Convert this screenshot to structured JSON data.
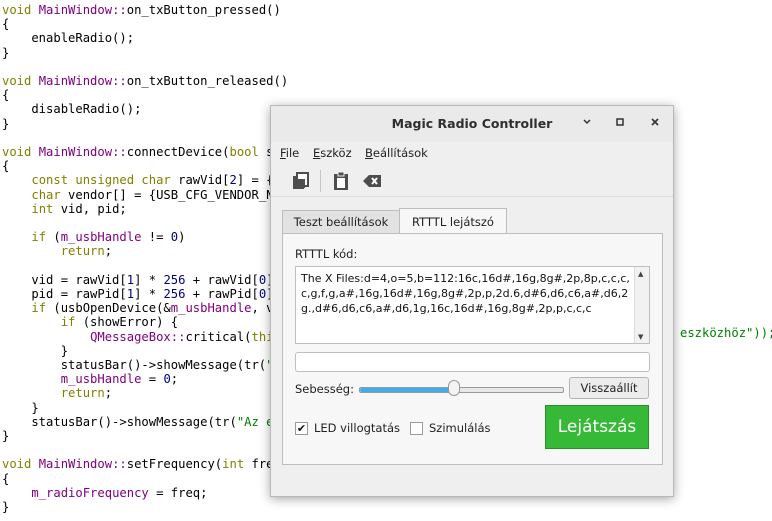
{
  "code_lines": [
    {
      "parts": [
        {
          "t": "void ",
          "c": "kw"
        },
        {
          "t": "MainWindow",
          "c": "cls"
        },
        {
          "t": "::",
          "c": "sym"
        },
        {
          "t": "on_txButton_pressed()",
          "c": ""
        }
      ]
    },
    {
      "parts": [
        {
          "t": "{",
          "c": ""
        }
      ]
    },
    {
      "parts": [
        {
          "t": "    enableRadio();",
          "c": ""
        }
      ]
    },
    {
      "parts": [
        {
          "t": "}",
          "c": ""
        }
      ]
    },
    {
      "parts": [
        {
          "t": "",
          "c": ""
        }
      ]
    },
    {
      "parts": [
        {
          "t": "void ",
          "c": "kw"
        },
        {
          "t": "MainWindow",
          "c": "cls"
        },
        {
          "t": "::",
          "c": "sym"
        },
        {
          "t": "on_txButton_released()",
          "c": ""
        }
      ]
    },
    {
      "parts": [
        {
          "t": "{",
          "c": ""
        }
      ]
    },
    {
      "parts": [
        {
          "t": "    disableRadio();",
          "c": ""
        }
      ]
    },
    {
      "parts": [
        {
          "t": "}",
          "c": ""
        }
      ]
    },
    {
      "parts": [
        {
          "t": "",
          "c": ""
        }
      ]
    },
    {
      "parts": [
        {
          "t": "void ",
          "c": "kw"
        },
        {
          "t": "MainWindow",
          "c": "cls"
        },
        {
          "t": "::",
          "c": "sym"
        },
        {
          "t": "connectDevice(",
          "c": ""
        },
        {
          "t": "bool ",
          "c": "kw"
        },
        {
          "t": "sh",
          "c": ""
        }
      ]
    },
    {
      "parts": [
        {
          "t": "{",
          "c": ""
        }
      ]
    },
    {
      "parts": [
        {
          "t": "    ",
          "c": ""
        },
        {
          "t": "const unsigned char ",
          "c": "kw"
        },
        {
          "t": "rawVid[",
          "c": ""
        },
        {
          "t": "2",
          "c": "num"
        },
        {
          "t": "] = {U",
          "c": ""
        }
      ]
    },
    {
      "parts": [
        {
          "t": "    ",
          "c": ""
        },
        {
          "t": "char ",
          "c": "kw"
        },
        {
          "t": "vendor[] = {USB_CFG_VENDOR_NAM",
          "c": ""
        }
      ]
    },
    {
      "parts": [
        {
          "t": "    ",
          "c": ""
        },
        {
          "t": "int ",
          "c": "kw"
        },
        {
          "t": "vid, pid;",
          "c": ""
        }
      ]
    },
    {
      "parts": [
        {
          "t": "",
          "c": ""
        }
      ]
    },
    {
      "parts": [
        {
          "t": "    ",
          "c": ""
        },
        {
          "t": "if ",
          "c": "kw"
        },
        {
          "t": "(",
          "c": ""
        },
        {
          "t": "m_usbHandle",
          "c": "cls"
        },
        {
          "t": " != ",
          "c": ""
        },
        {
          "t": "0",
          "c": "num"
        },
        {
          "t": ")",
          "c": ""
        }
      ]
    },
    {
      "parts": [
        {
          "t": "        ",
          "c": ""
        },
        {
          "t": "return",
          "c": "kw"
        },
        {
          "t": ";",
          "c": ""
        }
      ]
    },
    {
      "parts": [
        {
          "t": "",
          "c": ""
        }
      ]
    },
    {
      "parts": [
        {
          "t": "    vid = rawVid[",
          "c": ""
        },
        {
          "t": "1",
          "c": "num"
        },
        {
          "t": "] * ",
          "c": ""
        },
        {
          "t": "256",
          "c": "num"
        },
        {
          "t": " + rawVid[",
          "c": ""
        },
        {
          "t": "0",
          "c": "num"
        },
        {
          "t": "];",
          "c": ""
        }
      ]
    },
    {
      "parts": [
        {
          "t": "    pid = rawPid[",
          "c": ""
        },
        {
          "t": "1",
          "c": "num"
        },
        {
          "t": "] * ",
          "c": ""
        },
        {
          "t": "256",
          "c": "num"
        },
        {
          "t": " + rawPid[",
          "c": ""
        },
        {
          "t": "0",
          "c": "num"
        },
        {
          "t": "];",
          "c": ""
        }
      ]
    },
    {
      "parts": [
        {
          "t": "    ",
          "c": ""
        },
        {
          "t": "if ",
          "c": "kw"
        },
        {
          "t": "(usbOpenDevice(&",
          "c": ""
        },
        {
          "t": "m_usbHandle",
          "c": "cls"
        },
        {
          "t": ", vi",
          "c": ""
        }
      ]
    },
    {
      "parts": [
        {
          "t": "        ",
          "c": ""
        },
        {
          "t": "if ",
          "c": "kw"
        },
        {
          "t": "(showError) {",
          "c": ""
        }
      ]
    },
    {
      "parts": [
        {
          "t": "            ",
          "c": ""
        },
        {
          "t": "QMessageBox",
          "c": "cls"
        },
        {
          "t": "::",
          "c": "sym"
        },
        {
          "t": "critical(",
          "c": ""
        },
        {
          "t": "this",
          "c": "kw"
        }
      ]
    },
    {
      "parts": [
        {
          "t": "        }",
          "c": ""
        }
      ]
    },
    {
      "parts": [
        {
          "t": "        statusBar()->showMessage(tr(",
          "c": ""
        },
        {
          "t": "\"N",
          "c": "str"
        }
      ]
    },
    {
      "parts": [
        {
          "t": "        ",
          "c": ""
        },
        {
          "t": "m_usbHandle",
          "c": "cls"
        },
        {
          "t": " = ",
          "c": ""
        },
        {
          "t": "0",
          "c": "num"
        },
        {
          "t": ";",
          "c": ""
        }
      ]
    },
    {
      "parts": [
        {
          "t": "        ",
          "c": ""
        },
        {
          "t": "return",
          "c": "kw"
        },
        {
          "t": ";",
          "c": ""
        }
      ]
    },
    {
      "parts": [
        {
          "t": "    }",
          "c": ""
        }
      ]
    },
    {
      "parts": [
        {
          "t": "    statusBar()->showMessage(tr(",
          "c": ""
        },
        {
          "t": "\"Az es",
          "c": "str"
        }
      ]
    },
    {
      "parts": [
        {
          "t": "}",
          "c": ""
        }
      ]
    },
    {
      "parts": [
        {
          "t": "",
          "c": ""
        }
      ]
    },
    {
      "parts": [
        {
          "t": "void ",
          "c": "kw"
        },
        {
          "t": "MainWindow",
          "c": "cls"
        },
        {
          "t": "::",
          "c": "sym"
        },
        {
          "t": "setFrequency(",
          "c": ""
        },
        {
          "t": "int ",
          "c": "kw"
        },
        {
          "t": "freq",
          "c": ""
        }
      ]
    },
    {
      "parts": [
        {
          "t": "{",
          "c": ""
        }
      ]
    },
    {
      "parts": [
        {
          "t": "    ",
          "c": ""
        },
        {
          "t": "m_radioFrequency",
          "c": "cls"
        },
        {
          "t": " = freq;",
          "c": ""
        }
      ]
    },
    {
      "parts": [
        {
          "t": "}",
          "c": ""
        }
      ]
    }
  ],
  "code_overflow_text": "eszközhöz\"));",
  "window": {
    "title": "Magic Radio Controller",
    "menu": {
      "file": "File",
      "device": "Eszköz",
      "settings": "Beállítások"
    },
    "tabs": [
      "Teszt beállítások",
      "RTTTL lejátszó"
    ],
    "rtttl_label": "RTTTL kód:",
    "rtttl_code": "The X Files:d=4,o=5,b=112:16c,16d#,16g,8g#,2p,8p,c,c,c,c,g,f,g,a#,16g,16d#,16g,8g#,2p,p,2d.6,d#6,d6,c6,a#,d6,2g.,d#6,d6,c6,a#,d6,1g,16c,16d#,16g,8g#,2p,p,c,c,c",
    "speed_label": "Sebesség:",
    "speed_value": 0.47,
    "reset_button": "Visszaállít",
    "led_checkbox": "LED villogtatás",
    "led_checked": true,
    "sim_checkbox": "Szimulálás",
    "sim_checked": false,
    "play_button": "Lejátszás",
    "play_color": "#36b936"
  }
}
